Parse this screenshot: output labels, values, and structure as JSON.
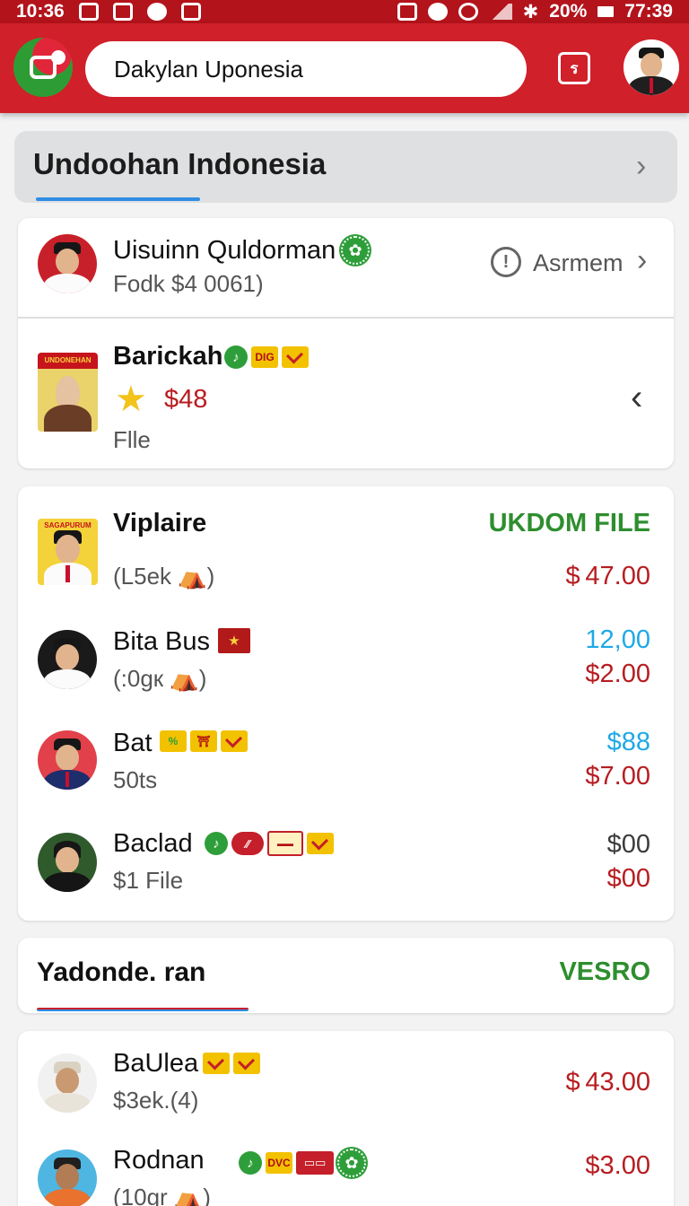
{
  "status_bar": {
    "time": "10:36",
    "battery": "20%",
    "clock": "77:39"
  },
  "header": {
    "search_value": "Dakylan Uponesia",
    "button_label": "ร"
  },
  "section_title": "Undoohan Indonesia",
  "card1": {
    "row1": {
      "name": "Uisuinn Quldorman",
      "sub": "Fodk $4 0061)",
      "action": "Asrmem"
    },
    "row2": {
      "name": "Barickah",
      "price": "$48",
      "sub": "Flle",
      "poster_text": "UNDONEHAN",
      "badge_text": "DIG"
    }
  },
  "card2": {
    "header_right": "UKDOM FILE",
    "items": [
      {
        "name": "Viplaire",
        "sub": "(L5ek ⛺)",
        "price_top": "",
        "price_bottom": "$ 47.00",
        "poster_text": "SAGAPURUM"
      },
      {
        "name": "Bita Bus",
        "sub": "(:0gк ⛺)",
        "price_top": "12,00",
        "price_bottom": "$2.00"
      },
      {
        "name": "Bat",
        "sub": "50ts",
        "price_top": "$88",
        "price_bottom": "$7.00"
      },
      {
        "name": "Baclad",
        "sub": "$1 File",
        "price_top": "$00",
        "price_bottom": "$00"
      }
    ]
  },
  "card3": {
    "title": "Yadonde. ran",
    "right": "VESRO"
  },
  "card4": {
    "items": [
      {
        "name": "BaUlea",
        "sub": "$3ek.(4)",
        "price": "$ 43.00"
      },
      {
        "name": "Rodnan",
        "sub": "(10gr ⛺)",
        "price": "$3.00",
        "badge_text": "DVC"
      }
    ]
  },
  "icons": [
    "app-logo-icon",
    "share-icon",
    "info-icon",
    "star-icon",
    "chevron-right-icon",
    "chevron-left-icon"
  ],
  "colors": {
    "brand_red": "#d0202a",
    "status_red": "#b3131b",
    "price_red": "#b71d21",
    "price_blue": "#1ea9e6",
    "accent_green": "#2e8e2e",
    "tab_blue": "#2f8de4"
  }
}
